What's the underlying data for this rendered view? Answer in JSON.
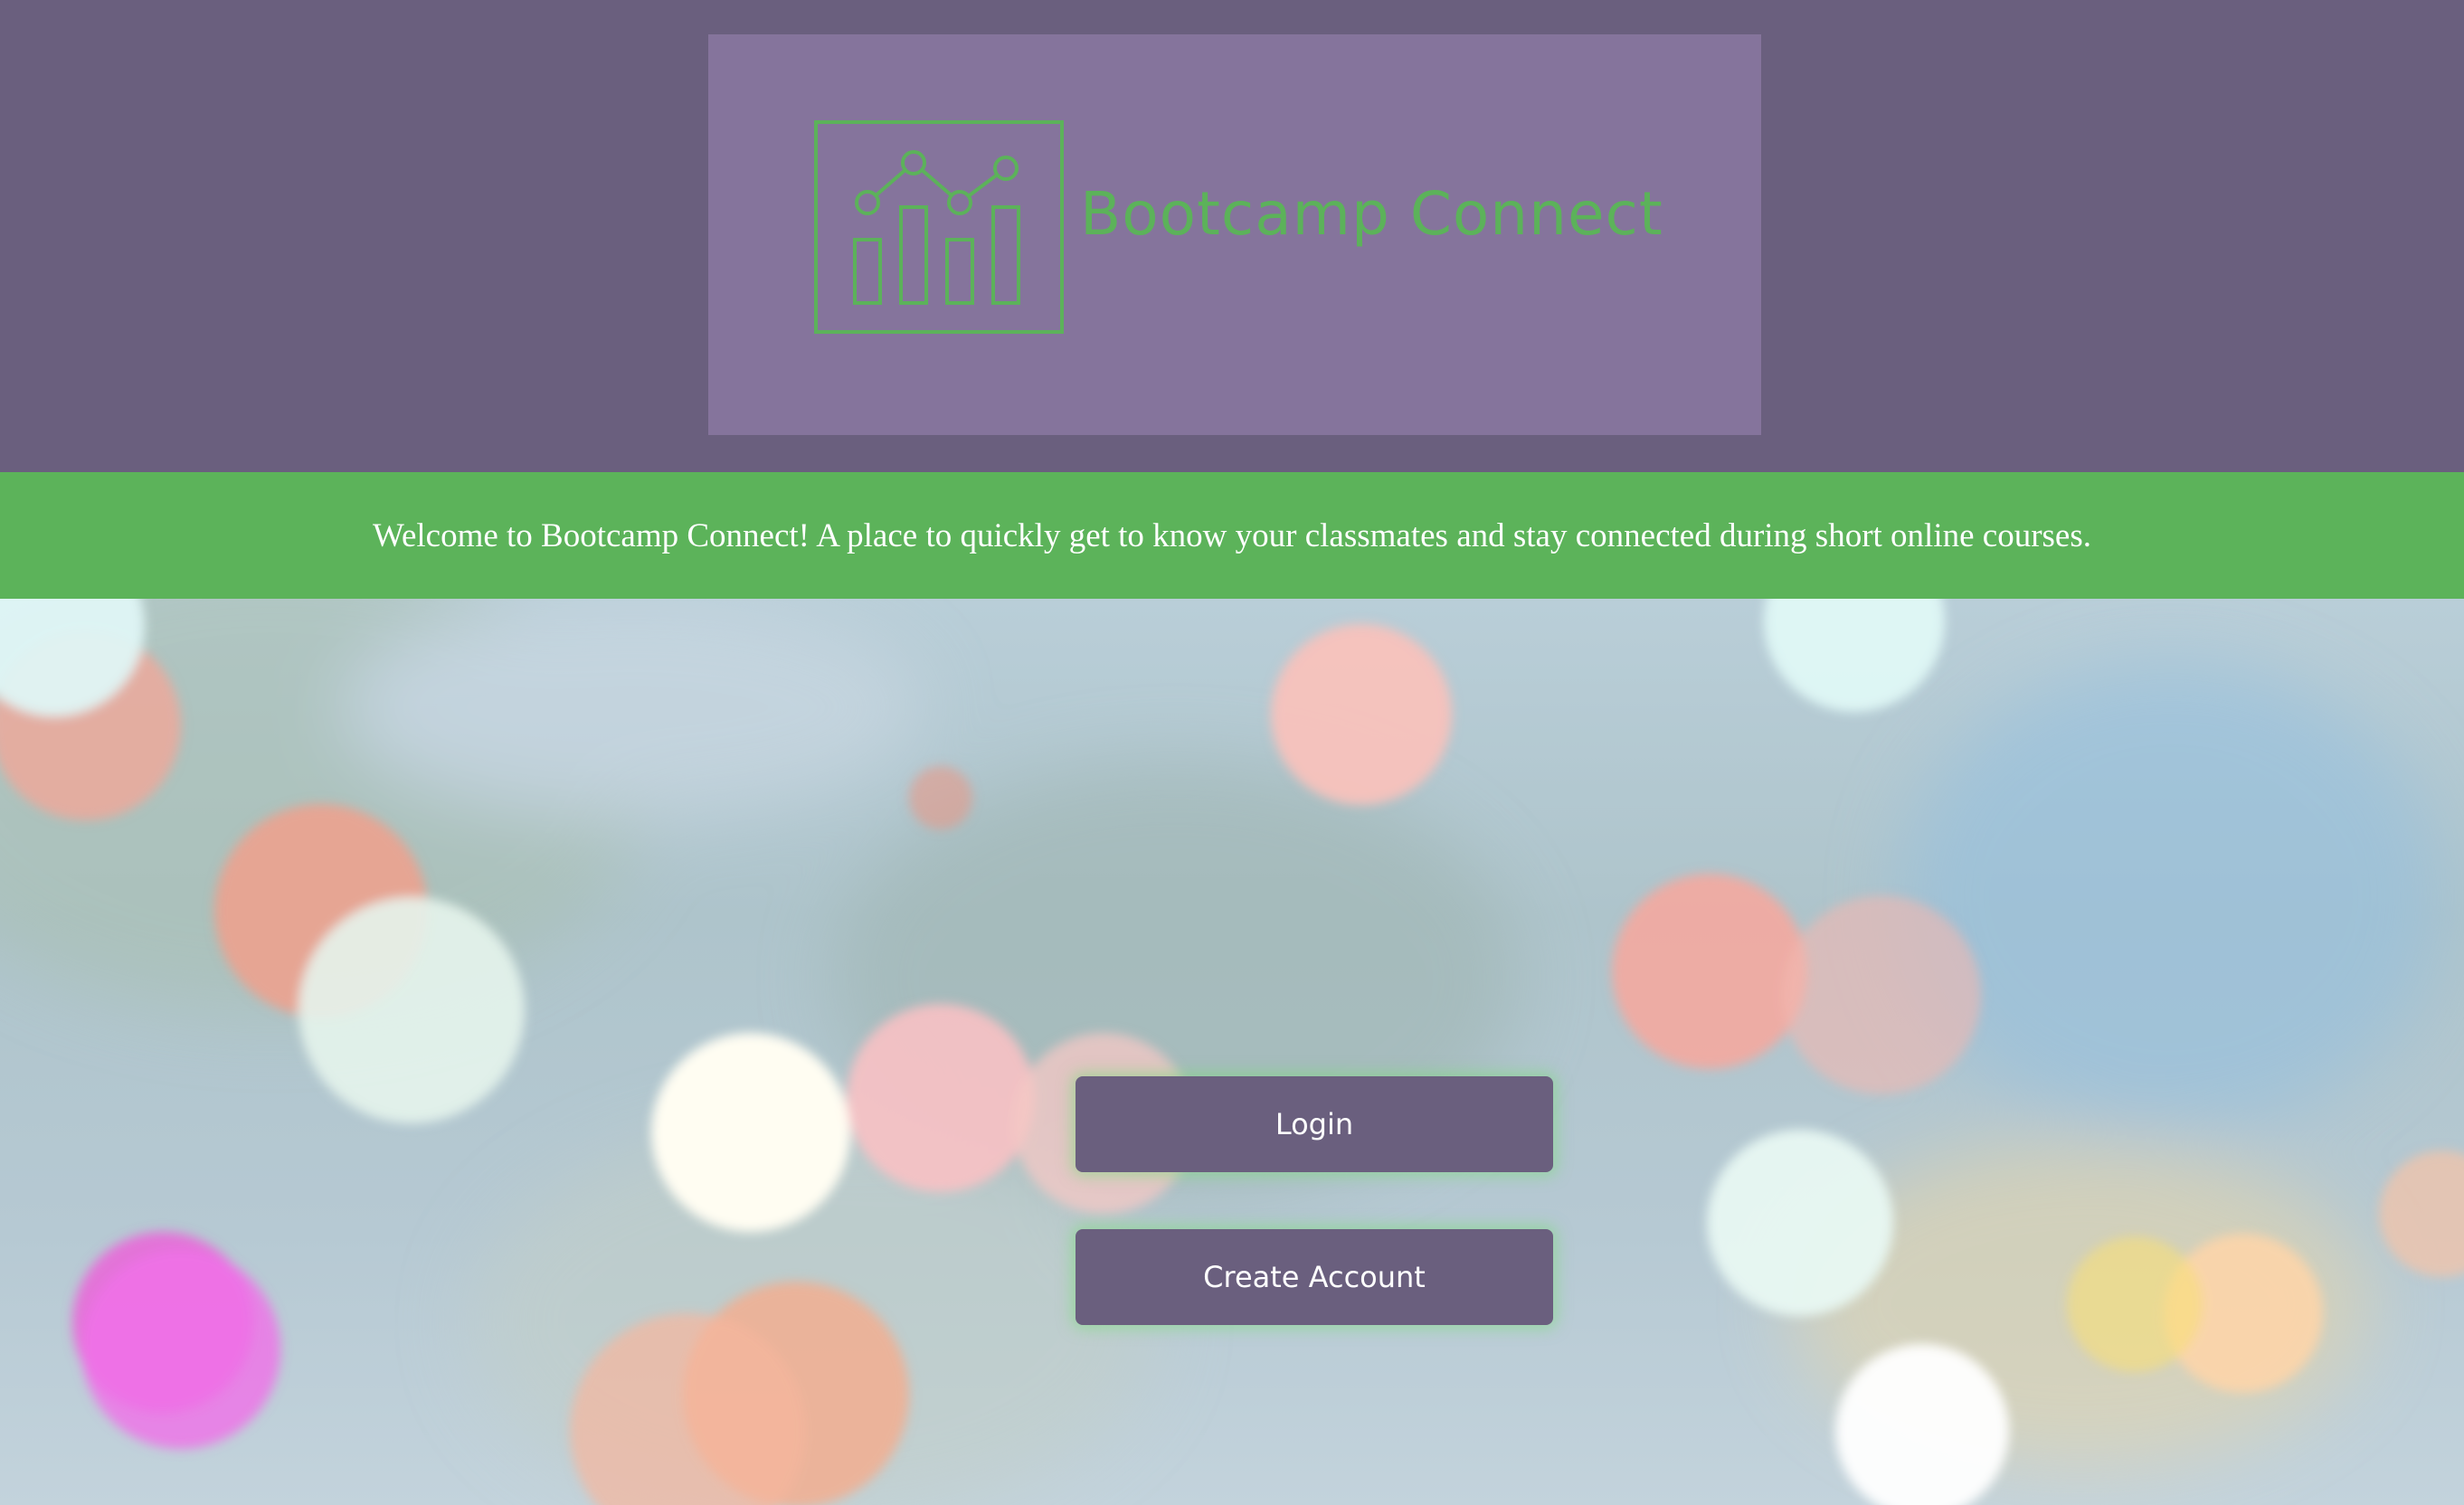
{
  "brand": {
    "name": "Bootcamp Connect",
    "logo_icon": "line-and-bar-chart-icon",
    "logo_box_color": "#85749c",
    "logo_color": "#5cb25a"
  },
  "welcome": {
    "message": "Welcome to Bootcamp Connect! A place to quickly get to know your classmates and stay connected during short online courses."
  },
  "actions": {
    "login_label": "Login",
    "create_account_label": "Create Account"
  },
  "colors": {
    "header_bg": "#6a5f7e",
    "banner_bg": "#5cb35a",
    "button_bg": "#6a5f7e",
    "button_glow": "#78dc78"
  }
}
